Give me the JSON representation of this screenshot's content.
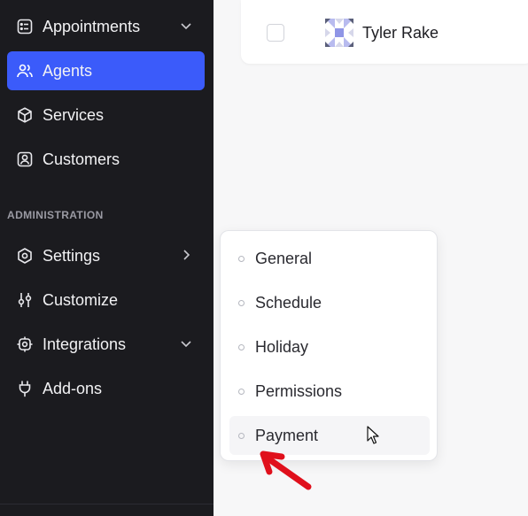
{
  "sidebar": {
    "items": [
      {
        "label": "Appointments",
        "icon": "calendar-list-icon",
        "chevron": "chevron-down-icon"
      },
      {
        "label": "Agents",
        "icon": "users-icon",
        "active": true
      },
      {
        "label": "Services",
        "icon": "cube-icon"
      },
      {
        "label": "Customers",
        "icon": "customer-icon"
      }
    ],
    "section_label": "ADMINISTRATION",
    "admin_items": [
      {
        "label": "Settings",
        "icon": "hexagon-gear-icon",
        "chevron": "chevron-right-icon"
      },
      {
        "label": "Customize",
        "icon": "sliders-icon"
      },
      {
        "label": "Integrations",
        "icon": "integrations-icon",
        "chevron": "chevron-down-icon"
      },
      {
        "label": "Add-ons",
        "icon": "plug-icon"
      }
    ]
  },
  "main": {
    "agent_row": {
      "name": "Tyler Rake"
    }
  },
  "settings_submenu": {
    "items": [
      {
        "label": "General"
      },
      {
        "label": "Schedule"
      },
      {
        "label": "Holiday"
      },
      {
        "label": "Permissions"
      },
      {
        "label": "Payment",
        "hovered": true
      }
    ]
  },
  "colors": {
    "sidebar_bg": "#1b1b1f",
    "active_bg": "#3b5bfa",
    "annotation_arrow": "#e0101c"
  }
}
